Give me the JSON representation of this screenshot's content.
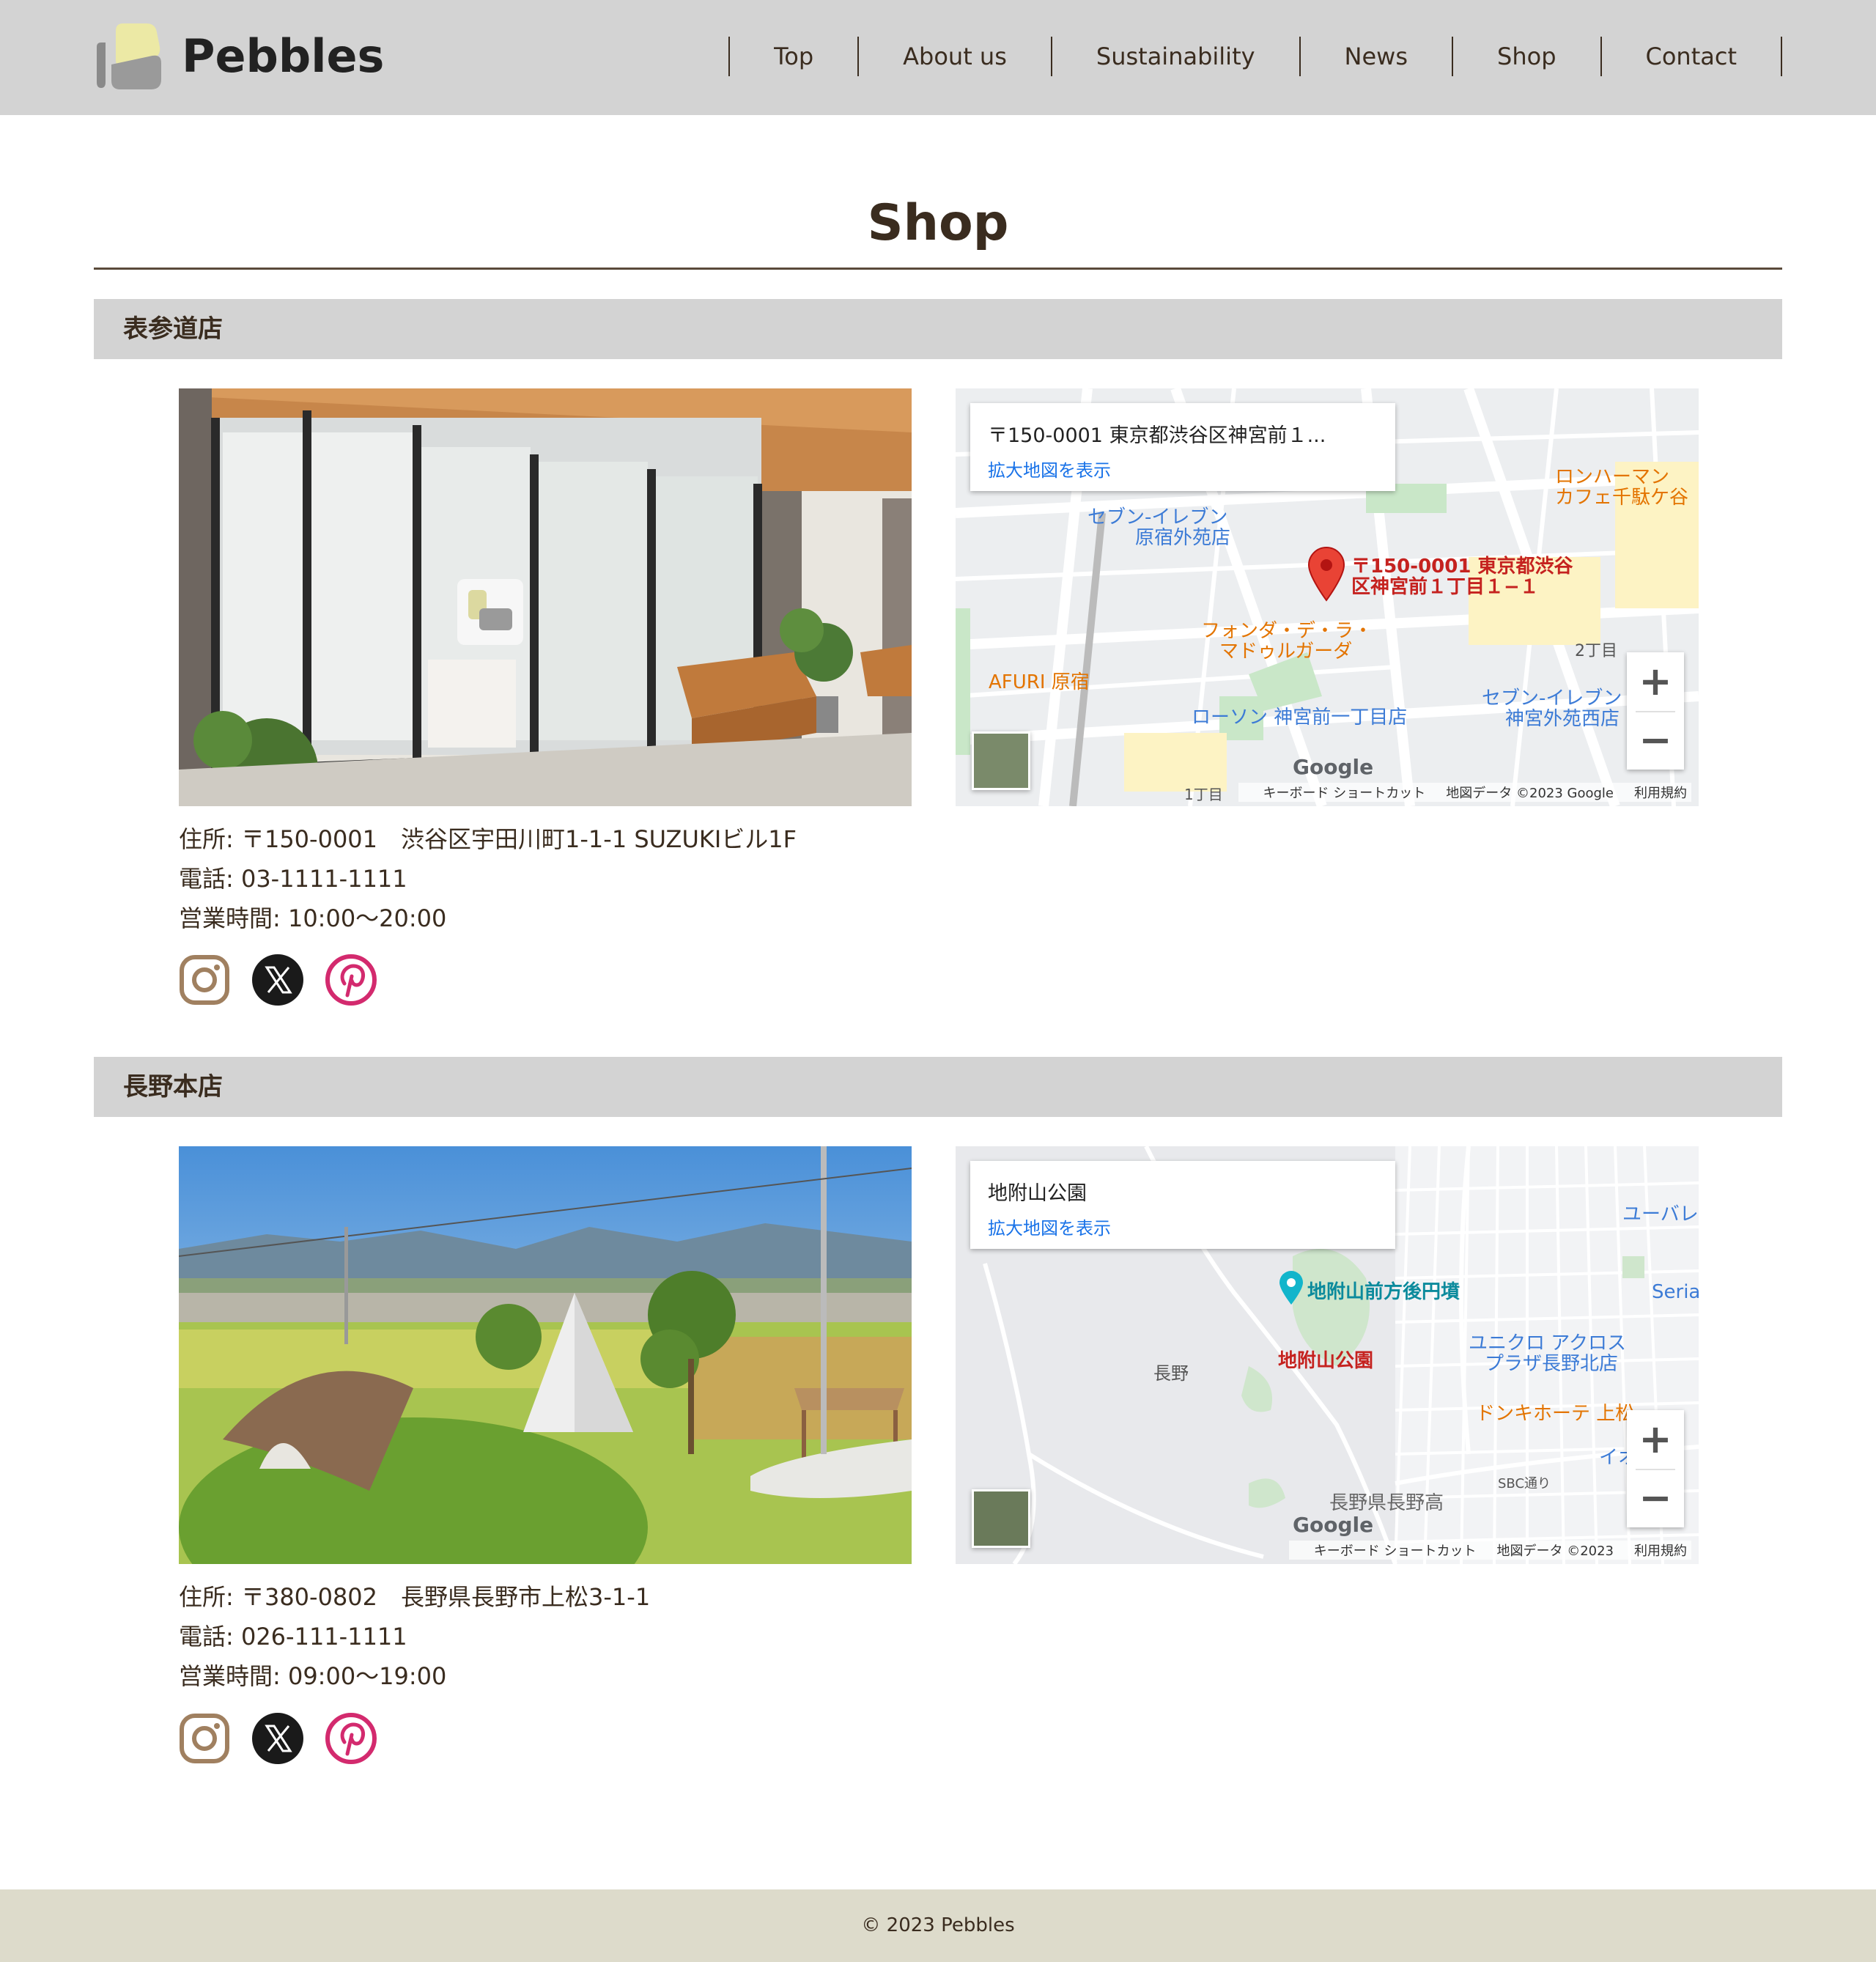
{
  "brand": {
    "name": "Pebbles"
  },
  "nav": {
    "items": [
      "Top",
      "About us",
      "Sustainability",
      "News",
      "Shop",
      "Contact"
    ]
  },
  "page": {
    "title": "Shop"
  },
  "shops": [
    {
      "name": "表参道店",
      "address": "住所: 〒150-0001　渋谷区宇田川町1-1-1 SUZUKIビル1F",
      "phone": "電話: 03-1111-1111",
      "hours": "営業時間: 10:00〜20:00",
      "map": {
        "card_title": "〒150-0001 東京都渋谷区神宮前１...",
        "card_link": "拡大地図を表示",
        "pin_label_line1": "〒150-0001 東京都渋谷",
        "pin_label_line2": "区神宮前１丁目１−１",
        "labels": [
          "セブン-イレブン",
          "原宿外苑店",
          "フォンダ・デ・ラ・",
          "マドゥルガーダ",
          "AFURI 原宿",
          "ローソン 神宮前一丁目店",
          "セブン-イレブン",
          "神宮外苑西店",
          "ロンハーマン",
          "カフェ千駄ケ谷",
          "2丁目",
          "1丁目"
        ],
        "footer": [
          "キーボード ショートカット",
          "地図データ ©2023 Google",
          "利用規約"
        ]
      }
    },
    {
      "name": "長野本店",
      "address": "住所: 〒380-0802　長野県長野市上松3-1-1",
      "phone": "電話: 026-111-1111",
      "hours": "営業時間: 09:00〜19:00",
      "map": {
        "card_title": "地附山公園",
        "card_link": "拡大地図を表示",
        "pin_label_line1": "地附山公園",
        "labels": [
          "地附山前方後円墳",
          "長野",
          "ユニクロ アクロス",
          "プラザ長野北店",
          "ドンキホーテ 上松",
          "長野県長野高",
          "ユーバレ",
          "イオン",
          "SBC通り",
          "Seria"
        ],
        "footer": [
          "キーボード ショートカット",
          "地図データ ©2023",
          "利用規約"
        ]
      }
    }
  ],
  "map_ui": {
    "zoom_in": "+",
    "zoom_out": "−",
    "google": "Google"
  },
  "social_icons": [
    "instagram-icon",
    "x-icon",
    "pinterest-icon"
  ],
  "footer": {
    "copyright": "© 2023 Pebbles"
  },
  "colors": {
    "header_bg": "#d3d3d3",
    "text": "#3a2c1f",
    "footer_bg": "#dddbcb",
    "instagram": "#a08060",
    "x": "#1a1a1a",
    "pinterest": "#d32a6e"
  }
}
